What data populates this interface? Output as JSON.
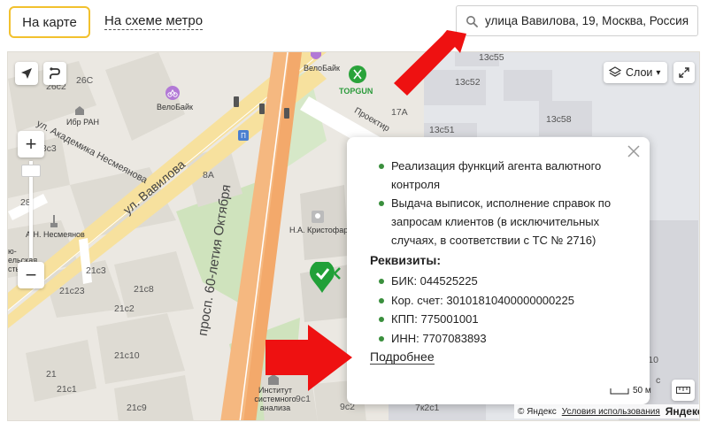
{
  "tabs": {
    "map": "На карте",
    "metro": "На схеме метро"
  },
  "search": {
    "value": "улица Вавилова, 19, Москва, Россия"
  },
  "map": {
    "layers_label": "Слои",
    "streets": {
      "vavilova": "ул. Вавилова",
      "akademika": "ул. Академика Несмеянова",
      "prospekt": "просп. 60-летия Октября",
      "proektny": "Проектир"
    },
    "labels": {
      "b26c2": "26c2",
      "b26c": "26С",
      "ibr": "Ибр РАН",
      "velobike1": "ВелоБайк",
      "velobike2": "ВелоБайк",
      "topgun": "TOPGUN",
      "b28c3": "28с3",
      "b8a": "8А",
      "nesmeyanov": "А.Н. Несмеянов",
      "kristofar": "Н.А. Кристофар",
      "b21c3": "21с3",
      "b21c23": "21с23",
      "b21c8": "21с8",
      "b21c2": "21с2",
      "b21c10": "21с10",
      "b21": "21",
      "b21c1": "21с1",
      "b21c9": "21с9",
      "b9c1": "9с1",
      "b9c2": "9с2",
      "b7k2c1": "7к2с1",
      "b13c52": "13с52",
      "b13c51": "13с51",
      "b13c58": "13с58",
      "b13c55": "13с55",
      "b17a": "17А",
      "institute": "Институт системного анализа",
      "frag_left": "ю-\nельская\nсть",
      "frag_28": "28",
      "frag_c10": "с10",
      "frag_s": "с"
    },
    "scale_label": "50 м",
    "copyright": "© Яндекс",
    "terms": "Условия использования",
    "logo": "Яндекс"
  },
  "popup": {
    "services": [
      "Реализация функций агента валютного контроля",
      "Выдача выписок, исполнение справок по запросам клиентов (в исключительных случаях, в соответствии с ТС № 2716)"
    ],
    "requisites_title": "Реквизиты:",
    "requisites": [
      "БИК: 044525225",
      "Кор. счет: 30101810400000000225",
      "КПП: 775001001",
      "ИНН: 7707083893"
    ],
    "more_link": "Подробнее"
  },
  "colors": {
    "accent": "#f2c12e",
    "arrow": "#ee1111",
    "bullet": "#3a8f3d",
    "road_major": "#f5b880",
    "road_minor": "#f7e19e"
  }
}
